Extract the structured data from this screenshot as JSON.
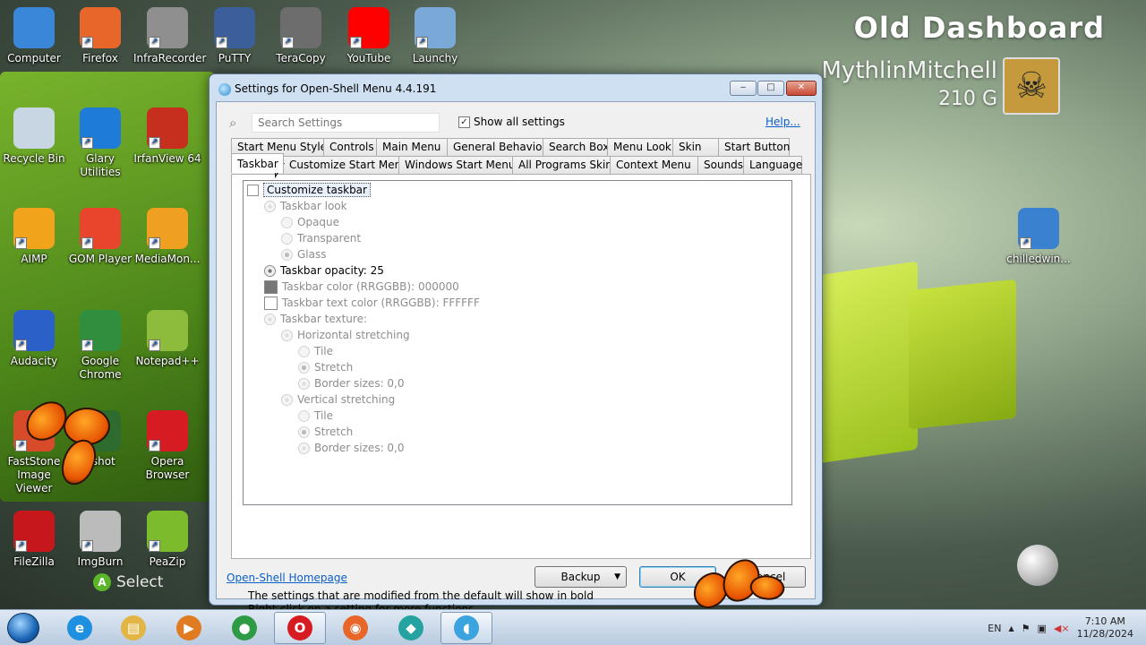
{
  "dashboard": {
    "title": "Old Dashboard",
    "gamertag": "MythlinMitchell",
    "gamerscore": "210",
    "gamerscore_icon": "G",
    "select_hint": "Select",
    "select_button": "A"
  },
  "desktop_icons": [
    {
      "label": "Computer",
      "icon": "computer-icon",
      "color": "#3a86d8"
    },
    {
      "label": "Firefox",
      "icon": "firefox-icon",
      "color": "#e8662a"
    },
    {
      "label": "InfraRecorder",
      "icon": "infrarecorder-icon",
      "color": "#8f8f8f"
    },
    {
      "label": "PuTTY",
      "icon": "putty-icon",
      "color": "#3b5f9a"
    },
    {
      "label": "TeraCopy",
      "icon": "teracopy-icon",
      "color": "#6d6d6d"
    },
    {
      "label": "YouTube",
      "icon": "youtube-icon",
      "color": "#ff0000"
    },
    {
      "label": "Launchy",
      "icon": "launchy-icon",
      "color": "#7aa9d8"
    },
    {
      "label": "Recycle Bin",
      "icon": "recycle-bin-icon",
      "color": "#c8d6e4"
    },
    {
      "label": "Glary Utilities",
      "icon": "glary-utilities-icon",
      "color": "#1e7bd8"
    },
    {
      "label": "IrfanView 64",
      "icon": "irfanview-icon",
      "color": "#c62e1e"
    },
    {
      "label": "AIMP",
      "icon": "aimp-icon",
      "color": "#f1a31b"
    },
    {
      "label": "GOM Player",
      "icon": "gom-player-icon",
      "color": "#e8452c"
    },
    {
      "label": "MediaMon...",
      "icon": "mediamonkey-icon",
      "color": "#f0a020"
    },
    {
      "label": "Audacity",
      "icon": "audacity-icon",
      "color": "#2c60c9"
    },
    {
      "label": "Google Chrome",
      "icon": "chrome-icon",
      "color": "#2f8f3f"
    },
    {
      "label": "Notepad++",
      "icon": "notepad-plus-plus-icon",
      "color": "#8dbb3b"
    },
    {
      "label": "FastStone Image Viewer",
      "icon": "faststone-icon",
      "color": "#d84b2a"
    },
    {
      "label": "nshot",
      "icon": "screenshot-icon",
      "color": "#2e6b2f"
    },
    {
      "label": "Opera Browser",
      "icon": "opera-icon",
      "color": "#d61c22"
    },
    {
      "label": "FileZilla",
      "icon": "filezilla-icon",
      "color": "#c6171c"
    },
    {
      "label": "ImgBurn",
      "icon": "imgburn-icon",
      "color": "#bbbbbb"
    },
    {
      "label": "PeaZip",
      "icon": "peazip-icon",
      "color": "#7cbc2c"
    },
    {
      "label": "chilledwin...",
      "icon": "windows-logo-icon",
      "color": "#3a82d0"
    }
  ],
  "dialog": {
    "title": "Settings for Open-Shell Menu 4.4.191",
    "minimize": "‒",
    "maximize": "□",
    "close": "✕",
    "search_placeholder": "Search Settings",
    "show_all_label": "Show all settings",
    "show_all_checked": "✓",
    "help_link": "Help...",
    "tabs_row1": [
      "Start Menu Style",
      "Controls",
      "Main Menu",
      "General Behavior",
      "Search Box",
      "Menu Look",
      "Skin",
      "Start Button"
    ],
    "tabs_row2": [
      "Taskbar",
      "Customize Start Menu",
      "Windows Start Menu",
      "All Programs Skin",
      "Context Menu",
      "Sounds",
      "Language"
    ],
    "active_tab": "Taskbar",
    "tree": [
      {
        "label": "Customize taskbar",
        "kind": "checkbox",
        "level": 0,
        "state": "selected"
      },
      {
        "label": "Taskbar look",
        "kind": "group",
        "level": 1,
        "state": "disabled"
      },
      {
        "label": "Opaque",
        "kind": "radio",
        "level": 2,
        "state": "disabled"
      },
      {
        "label": "Transparent",
        "kind": "radio",
        "level": 2,
        "state": "disabled"
      },
      {
        "label": "Glass",
        "kind": "radio-on",
        "level": 2,
        "state": "disabled"
      },
      {
        "label": "Taskbar opacity: 25",
        "kind": "group-en",
        "level": 1,
        "state": "bold"
      },
      {
        "label": "Taskbar color (RRGGBB): 000000",
        "kind": "swatch-dark",
        "level": 1,
        "state": "disabled"
      },
      {
        "label": "Taskbar text color (RRGGBB): FFFFFF",
        "kind": "swatch-light",
        "level": 1,
        "state": "disabled"
      },
      {
        "label": "Taskbar texture:",
        "kind": "group",
        "level": 1,
        "state": "disabled"
      },
      {
        "label": "Horizontal stretching",
        "kind": "group",
        "level": 2,
        "state": "disabled"
      },
      {
        "label": "Tile",
        "kind": "radio",
        "level": 3,
        "state": "disabled"
      },
      {
        "label": "Stretch",
        "kind": "radio-on",
        "level": 3,
        "state": "disabled"
      },
      {
        "label": "Border sizes: 0,0",
        "kind": "group",
        "level": 3,
        "state": "disabled"
      },
      {
        "label": "Vertical stretching",
        "kind": "group",
        "level": 2,
        "state": "disabled"
      },
      {
        "label": "Tile",
        "kind": "radio",
        "level": 3,
        "state": "disabled"
      },
      {
        "label": "Stretch",
        "kind": "radio-on",
        "level": 3,
        "state": "disabled"
      },
      {
        "label": "Border sizes: 0,0",
        "kind": "group",
        "level": 3,
        "state": "disabled"
      }
    ],
    "note1": "The settings that are modified from the default will show in bold",
    "note2": "Right-click on a setting for more functions",
    "homepage_link": "Open-Shell Homepage",
    "backup_button": "Backup",
    "backup_arrow": "▼",
    "ok_button": "OK",
    "cancel_button": "Cancel"
  },
  "taskbar": {
    "items": [
      {
        "name": "internet-explorer",
        "glyph": "e",
        "color": "#1f8fe0",
        "active": false
      },
      {
        "name": "file-explorer",
        "glyph": "▤",
        "color": "#e2b544",
        "active": false
      },
      {
        "name": "media-player",
        "glyph": "▶",
        "color": "#e07b22",
        "active": false
      },
      {
        "name": "chrome",
        "glyph": "●",
        "color": "#2f9a45",
        "active": false
      },
      {
        "name": "opera",
        "glyph": "O",
        "color": "#d61c22",
        "active": true
      },
      {
        "name": "firefox",
        "glyph": "◉",
        "color": "#e8662a",
        "active": false
      },
      {
        "name": "chat",
        "glyph": "◆",
        "color": "#25a3a0",
        "active": false
      },
      {
        "name": "open-shell",
        "glyph": "◖",
        "color": "#3ba3dd",
        "active": true
      }
    ],
    "language": "EN",
    "tray_arrow": "▲",
    "time": "7:10 AM",
    "date": "11/28/2024"
  }
}
